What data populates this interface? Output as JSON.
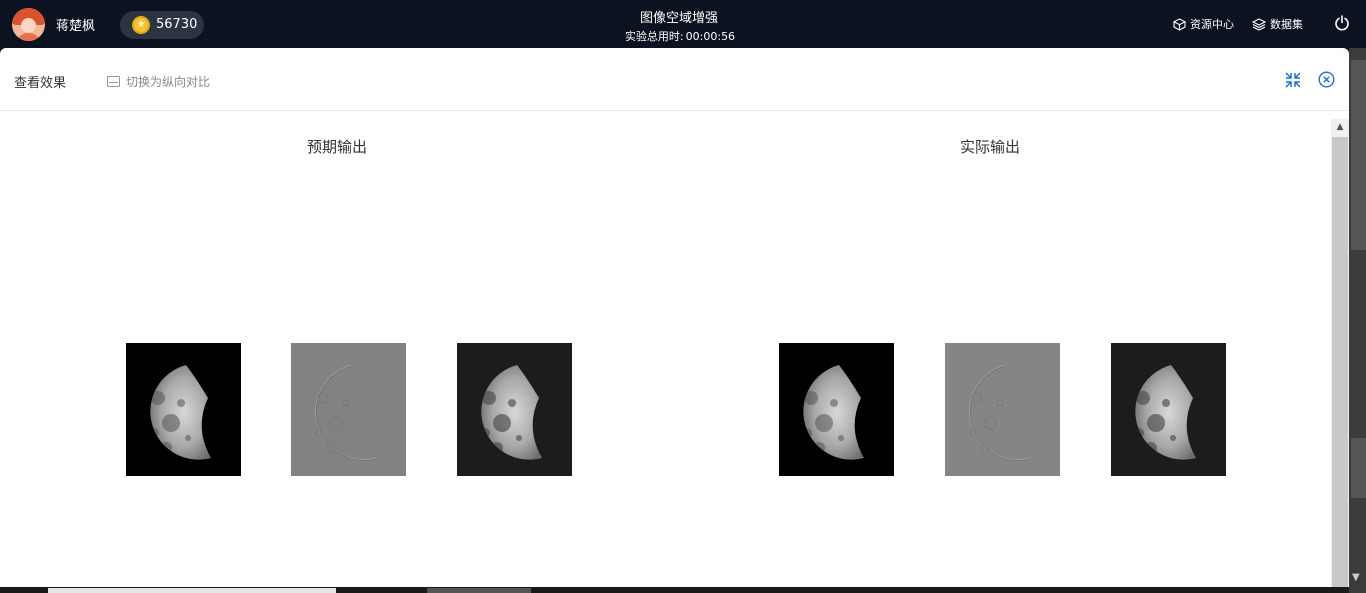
{
  "topbar": {
    "username": "蒋楚枫",
    "coins": "56730",
    "title": "图像空域增强",
    "timer_label": "实验总用时:",
    "timer_value": "00:00:56",
    "nav": {
      "resource_center": "资源中心",
      "dataset": "数据集"
    }
  },
  "dialog": {
    "title": "查看效果",
    "switch_label": "切换为纵向对比",
    "expected_title": "预期输出",
    "actual_title": "实际输出"
  },
  "images": {
    "expected": [
      "moon-original",
      "laplacian-result",
      "enhanced-moon"
    ],
    "actual": [
      "moon-original",
      "laplacian-result",
      "enhanced-moon"
    ]
  },
  "icons": {
    "avatar": "avatar-icon",
    "coin": "coin-icon",
    "resource": "cube-icon",
    "dataset": "layers-icon",
    "power": "power-icon",
    "switch": "switch-icon",
    "shrink": "shrink-icon",
    "close": "close-circle-icon"
  },
  "colors": {
    "topbar_bg": "#0b1320",
    "accent": "#1f6fd0",
    "coin": "#f4c430"
  }
}
